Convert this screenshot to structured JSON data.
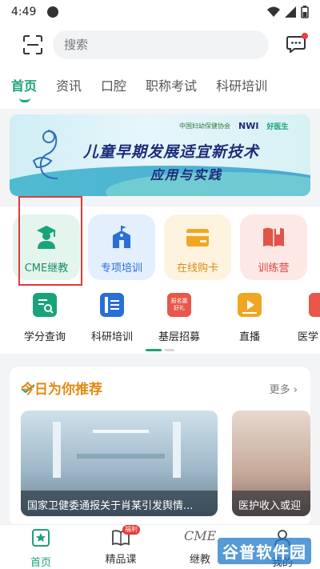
{
  "status_bar": {
    "time": "4:49"
  },
  "search": {
    "placeholder": "搜索"
  },
  "tabs": [
    {
      "label": "首页",
      "active": true
    },
    {
      "label": "资讯"
    },
    {
      "label": "口腔"
    },
    {
      "label": "职称考试"
    },
    {
      "label": "科研培训"
    }
  ],
  "banner": {
    "title": "儿童早期发展适宜新技术",
    "subtitle": "应用与实践",
    "logos": [
      "中国妇幼保健协会",
      "NWI",
      "好医生"
    ]
  },
  "features": [
    {
      "label": "CME继教",
      "icon": "graduate-icon"
    },
    {
      "label": "专项培训",
      "icon": "school-icon"
    },
    {
      "label": "在线购卡",
      "icon": "card-icon"
    },
    {
      "label": "训练营",
      "icon": "book-icon"
    }
  ],
  "quick_links": [
    {
      "label": "学分查询",
      "icon": "credit-query-icon"
    },
    {
      "label": "科研培训",
      "icon": "research-icon"
    },
    {
      "label": "基层招募",
      "icon": "recruit-icon",
      "icon_text": "报名赢好礼"
    },
    {
      "label": "直播",
      "icon": "live-icon"
    },
    {
      "label": "医学",
      "icon": "medical-icon"
    }
  ],
  "recommend": {
    "title": "今日为你推荐",
    "more": "更多",
    "cards": [
      {
        "caption": "国家卫健委通报关于肖某引发舆情..."
      },
      {
        "caption": "医护收入或迎"
      }
    ]
  },
  "bottom_nav": [
    {
      "label": "首页",
      "active": true
    },
    {
      "label": "精品课",
      "badge": "福利"
    },
    {
      "label": "继教",
      "icon_text": "CME"
    },
    {
      "label": "我的"
    }
  ],
  "watermark": "谷普软件园",
  "colors": {
    "accent": "#1aa37a",
    "recommend_title": "#e28a14",
    "highlight_box": "#e53935"
  }
}
